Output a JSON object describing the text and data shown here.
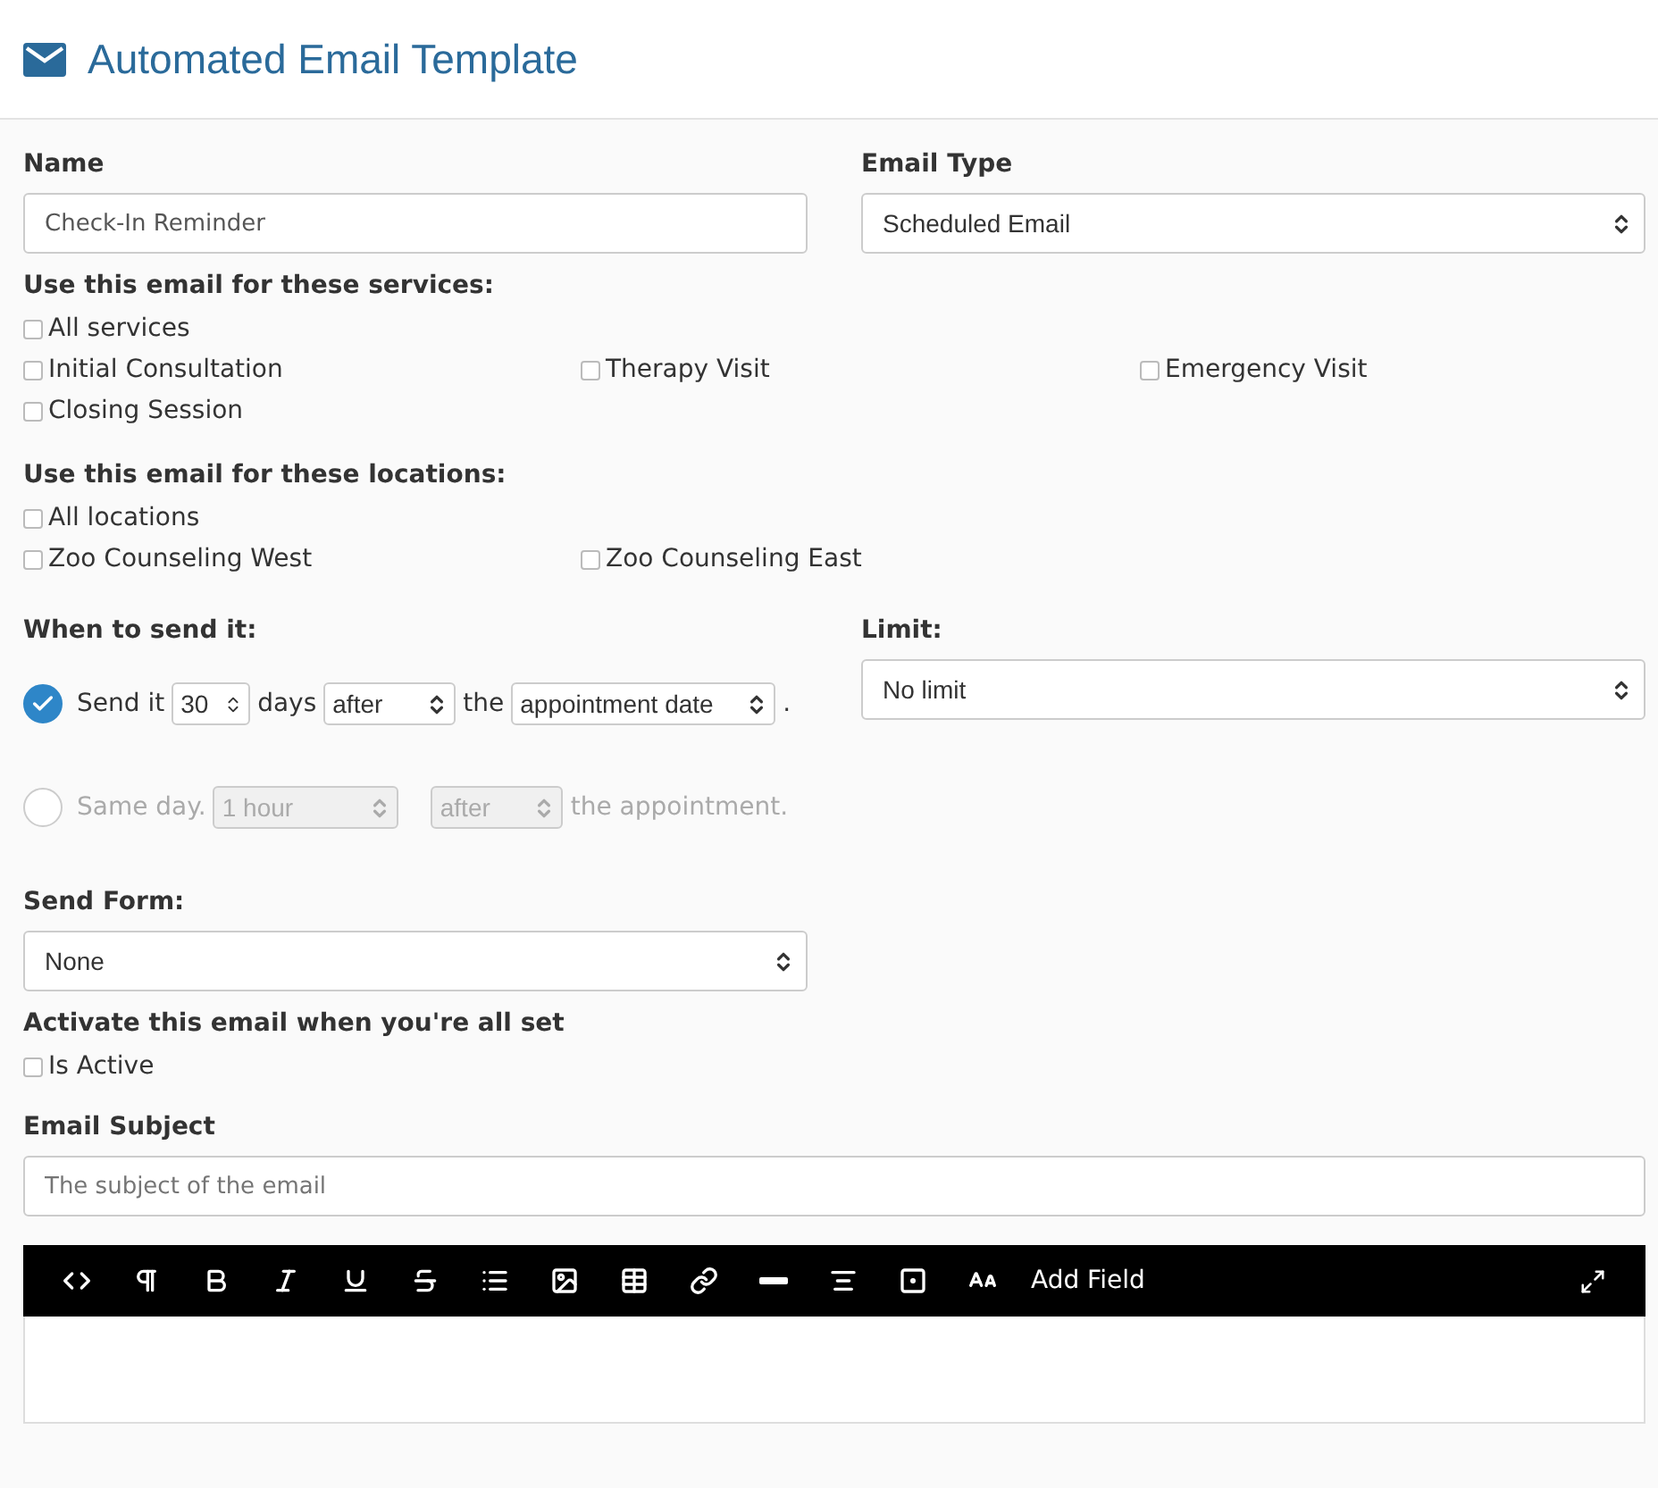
{
  "header": {
    "title": "Automated Email Template"
  },
  "name_field": {
    "label": "Name",
    "value": "Check-In Reminder"
  },
  "email_type": {
    "label": "Email Type",
    "value": "Scheduled Email"
  },
  "services": {
    "label": "Use this email for these services:",
    "all": {
      "label": "All services",
      "checked": false
    },
    "items": [
      {
        "label": "Initial Consultation",
        "checked": false
      },
      {
        "label": "Therapy Visit",
        "checked": false
      },
      {
        "label": "Emergency Visit",
        "checked": false
      },
      {
        "label": "Closing Session",
        "checked": false
      }
    ]
  },
  "locations": {
    "label": "Use this email for these locations:",
    "all": {
      "label": "All locations",
      "checked": false
    },
    "items": [
      {
        "label": "Zoo Counseling West",
        "checked": false
      },
      {
        "label": "Zoo Counseling East",
        "checked": false
      }
    ]
  },
  "timing": {
    "label": "When to send it:",
    "options": [
      {
        "kind": "days",
        "selected": true,
        "prefix": "Send it",
        "number": "30",
        "unit": "days",
        "direction": "after",
        "connector": "the",
        "reference": "appointment date",
        "suffix": "."
      },
      {
        "kind": "same_day",
        "selected": false,
        "prefix": "Same day.",
        "offset": "1 hour",
        "direction": "after",
        "suffix": "the appointment."
      }
    ]
  },
  "limit": {
    "label": "Limit:",
    "value": "No limit"
  },
  "send_form": {
    "label": "Send Form:",
    "value": "None"
  },
  "activate": {
    "label": "Activate this email when you're all set",
    "checkbox": {
      "label": "Is Active",
      "checked": false
    }
  },
  "subject": {
    "label": "Email Subject",
    "placeholder": "The subject of the email"
  },
  "editor": {
    "add_field": "Add Field"
  }
}
